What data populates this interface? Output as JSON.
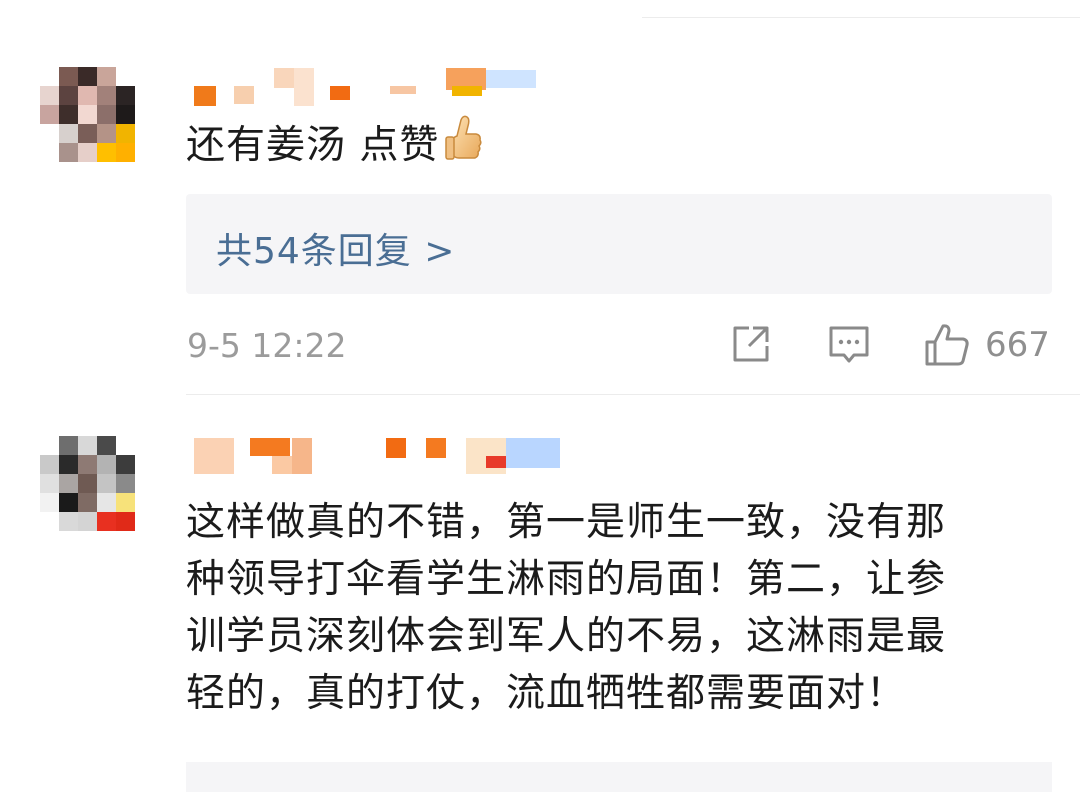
{
  "comments": [
    {
      "text": "还有姜汤 点赞",
      "emoji": "thumbs-up",
      "replies_label": "共54条回复 >",
      "time": "9-5 12:22",
      "like_count": "667"
    },
    {
      "text_lines": [
        "这样做真的不错，第一是师生一致，没有那",
        "种领导打伞看学生淋雨的局面！第二，让参",
        "训学员深刻体会到军人的不易，这淋雨是最",
        "轻的，真的打仗，流血牺牲都需要面对！"
      ]
    }
  ],
  "icons": {
    "share": "share-icon",
    "comment": "comment-icon",
    "like": "thumbs-up-icon"
  },
  "colors": {
    "link": "#4a6e94",
    "meta": "#9b9b9b",
    "reply_bg": "#f5f5f7"
  }
}
